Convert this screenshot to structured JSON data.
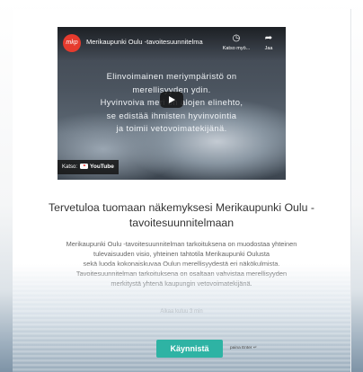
{
  "video": {
    "channel_logo": "mkp",
    "title": "Merikaupunki Oulu -tavoitesuunnitelma",
    "watch_later_icon": "clock-icon",
    "watch_later_label": "Katso myö...",
    "share_icon": "share-arrow-icon",
    "share_label": "Jaa",
    "overlay_lines": [
      "Elinvoimainen meriympäristö on",
      "merellisyyden ydin.",
      "Hyvinvoiva meri on alojen elinehto,",
      "se edistää ihmisten hyvinvointia",
      "ja toimii vetovoimatekijänä."
    ],
    "play_icon": "play-button-icon",
    "watch_on_label": "Katso:",
    "youtube_logo": "YouTube"
  },
  "intro": {
    "welcome_lines": [
      "Tervetuloa tuomaan näkemyksesi Merikaupunki Oulu -",
      "tavoitesuunnitelmaan"
    ],
    "description_lines": [
      "Merikaupunki Oulu -tavoitesuunnitelman tarkoituksena on muodostaa yhteinen",
      "tulevaisuuden visio, yhteinen tahtotila Merikaupunki Oulusta",
      "sekä luoda kokonaiskuvaa Oulun merellisyydestä eri näkökulmista.",
      "Tavoitesuunnitelman tarkoituksena on osaltaan vahvistaa merellisyyden",
      "merkitystä yhtenä kaupungin vetovoimatekijänä."
    ],
    "time_label": "Aikaa kuluu 3 min"
  },
  "actions": {
    "start_label": "Käynnistä",
    "enter_hint": "paina Enter ↵"
  },
  "colors": {
    "accent": "#2eb3a4",
    "channel_logo": "#e63b2e"
  }
}
